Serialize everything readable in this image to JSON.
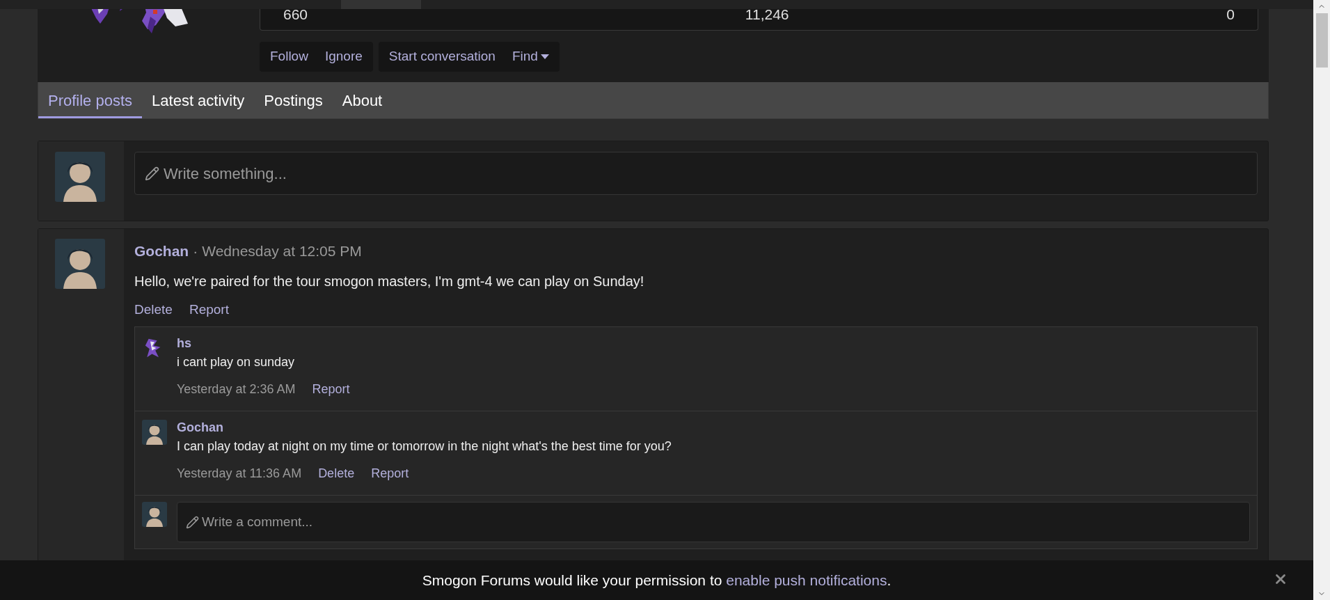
{
  "stats": [
    "660",
    "11,246",
    "0"
  ],
  "action_groups": [
    {
      "items": [
        {
          "label": "Follow",
          "kind": "link"
        },
        {
          "label": "Ignore",
          "kind": "link"
        }
      ]
    },
    {
      "items": [
        {
          "label": "Start conversation",
          "kind": "link"
        },
        {
          "label": "Find",
          "kind": "menu"
        }
      ]
    }
  ],
  "tabs": [
    {
      "label": "Profile posts",
      "selected": true
    },
    {
      "label": "Latest activity",
      "selected": false
    },
    {
      "label": "Postings",
      "selected": false
    },
    {
      "label": "About",
      "selected": false
    }
  ],
  "composer": {
    "placeholder": "Write something..."
  },
  "post": {
    "author": "Gochan",
    "separator": "·",
    "time": "Wednesday at 12:05 PM",
    "message": "Hello, we're paired for the tour smogon masters, I'm gmt-4 we can play on Sunday!",
    "actions": [
      "Delete",
      "Report"
    ],
    "comments": [
      {
        "author": "hs",
        "kind": "sprite",
        "text": "i cant play on sunday",
        "time": "Yesterday at 2:36 AM",
        "actions": [
          "Report"
        ]
      },
      {
        "author": "Gochan",
        "kind": "person",
        "text": "I can play today at night on my time or tomorrow in the night what's the best time for you?",
        "time": "Yesterday at 11:36 AM",
        "actions": [
          "Delete",
          "Report"
        ]
      }
    ],
    "comment_field": {
      "placeholder": "Write a comment..."
    }
  },
  "notice": {
    "text": "Smogon Forums would like your permission to",
    "link": "enable push notifications",
    "end": "."
  }
}
